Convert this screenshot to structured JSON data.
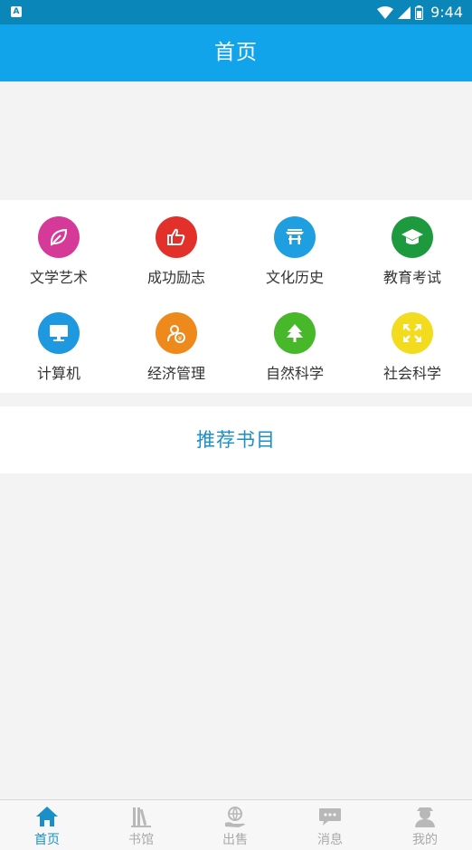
{
  "status_bar": {
    "time": "9:44",
    "app_icon_letter": "A"
  },
  "header": {
    "title": "首页"
  },
  "categories": [
    {
      "label": "文学艺术",
      "icon": "leaf-icon",
      "color": "#d63a98"
    },
    {
      "label": "成功励志",
      "icon": "thumbs-up-icon",
      "color": "#e2302a"
    },
    {
      "label": "文化历史",
      "icon": "pavilion-icon",
      "color": "#1f9ee0"
    },
    {
      "label": "教育考试",
      "icon": "graduation-cap-icon",
      "color": "#1d9a3e"
    },
    {
      "label": "计算机",
      "icon": "monitor-icon",
      "color": "#1e98de"
    },
    {
      "label": "经济管理",
      "icon": "money-person-icon",
      "color": "#ee8a1c"
    },
    {
      "label": "自然科学",
      "icon": "tree-icon",
      "color": "#47b82a"
    },
    {
      "label": "社会科学",
      "icon": "expand-arrows-icon",
      "color": "#f2dc1d"
    }
  ],
  "recommend": {
    "title": "推荐书目"
  },
  "bottom_nav": [
    {
      "label": "首页",
      "icon": "home-icon",
      "active": true
    },
    {
      "label": "书馆",
      "icon": "books-icon",
      "active": false
    },
    {
      "label": "出售",
      "icon": "globe-hand-icon",
      "active": false
    },
    {
      "label": "消息",
      "icon": "chat-bubble-icon",
      "active": false
    },
    {
      "label": "我的",
      "icon": "user-icon",
      "active": false
    }
  ],
  "colors": {
    "header_bg": "#11a4ea",
    "status_bg": "#0b86b8",
    "accent": "#1a8fc8",
    "inactive": "#a9a9a9"
  }
}
